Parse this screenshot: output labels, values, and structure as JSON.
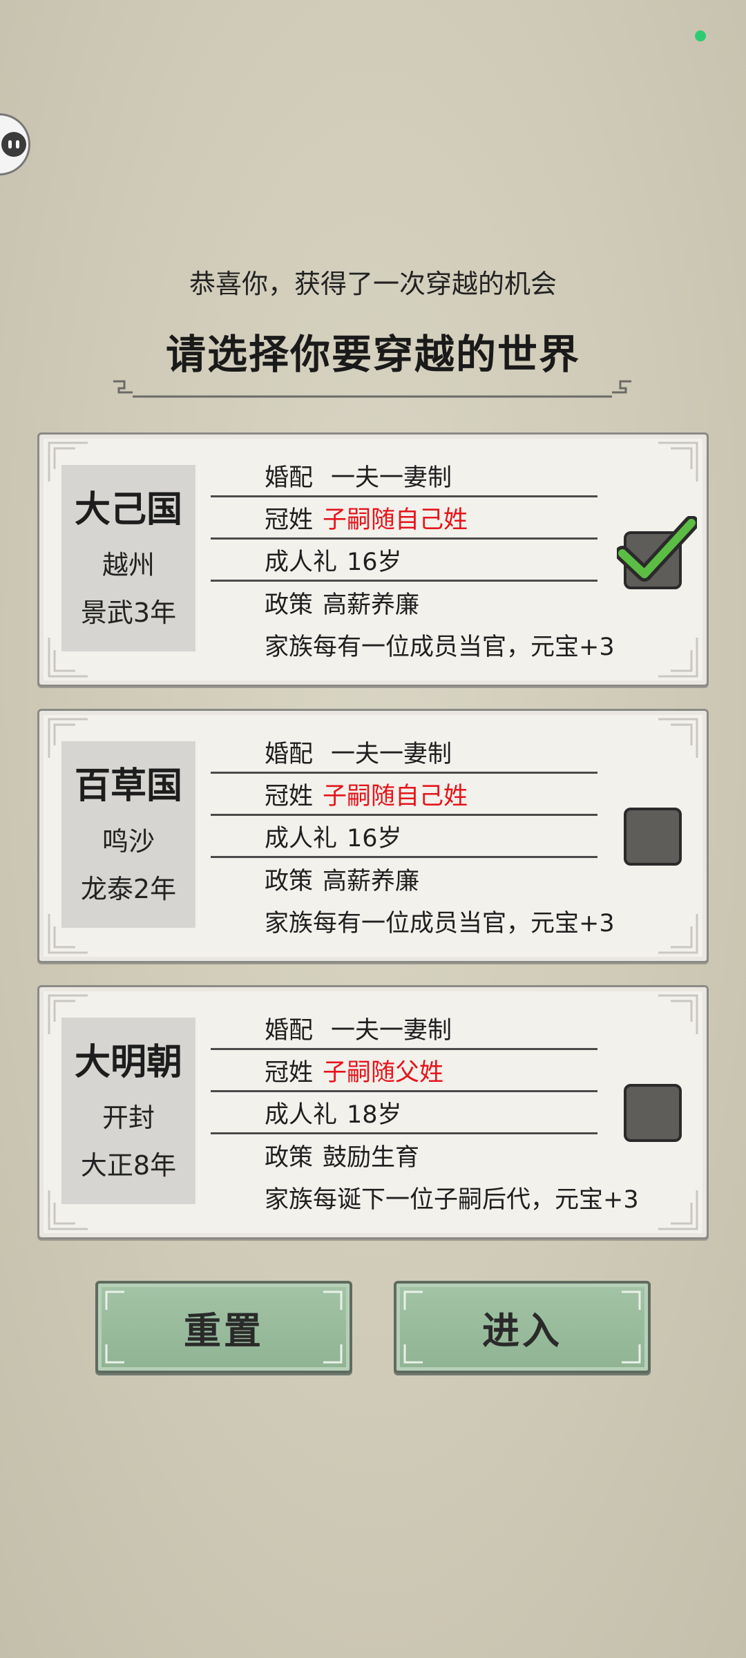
{
  "header": {
    "subtitle": "恭喜你，获得了一次穿越的机会",
    "title": "请选择你要穿越的世界"
  },
  "worlds": [
    {
      "name": "大己国",
      "region": "越州",
      "era": "景武3年",
      "marriage_label": "婚配",
      "marriage_value": "一夫一妻制",
      "surname_label": "冠姓",
      "surname_value": "子嗣随自己姓",
      "adulthood_label": "成人礼",
      "adulthood_value": "16岁",
      "policy_label": "政策",
      "policy_value": "高薪养廉",
      "policy_desc": "家族每有一位成员当官，元宝+3",
      "selected": true
    },
    {
      "name": "百草国",
      "region": "鸣沙",
      "era": "龙泰2年",
      "marriage_label": "婚配",
      "marriage_value": "一夫一妻制",
      "surname_label": "冠姓",
      "surname_value": "子嗣随自己姓",
      "adulthood_label": "成人礼",
      "adulthood_value": "16岁",
      "policy_label": "政策",
      "policy_value": "高薪养廉",
      "policy_desc": "家族每有一位成员当官，元宝+3",
      "selected": false
    },
    {
      "name": "大明朝",
      "region": "开封",
      "era": "大正8年",
      "marriage_label": "婚配",
      "marriage_value": "一夫一妻制",
      "surname_label": "冠姓",
      "surname_value": "子嗣随父姓",
      "adulthood_label": "成人礼",
      "adulthood_value": "18岁",
      "policy_label": "政策",
      "policy_value": "鼓励生育",
      "policy_desc": "家族每诞下一位子嗣后代，元宝+3",
      "selected": false
    }
  ],
  "buttons": {
    "reset": "重置",
    "enter": "进入"
  },
  "colors": {
    "accent_red": "#e6141a",
    "button_green": "#9dbfa1",
    "check_green": "#4caf50"
  }
}
